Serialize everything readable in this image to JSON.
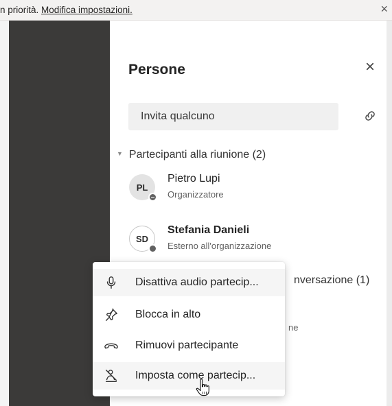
{
  "notification": {
    "text": "n priorità. ",
    "link": "Modifica impostazioni.",
    "close_glyph": "×"
  },
  "panel": {
    "title": "Persone",
    "close_glyph": "×",
    "invite_placeholder": "Invita qualcuno"
  },
  "meeting_section": {
    "label": "Partecipanti alla riunione (2)",
    "participants": [
      {
        "initials": "PL",
        "name": "Pietro Lupi",
        "role": "Organizzatore"
      },
      {
        "initials": "SD",
        "name": "Stefania Danieli",
        "role": "Esterno all'organizzazione"
      }
    ]
  },
  "partially_hidden": {
    "conversation_section": "nversazione (1)",
    "role_fragment": "ne"
  },
  "context_menu": {
    "items": [
      {
        "label": "Disattiva audio partecip...",
        "icon": "microphone-icon"
      },
      {
        "label": "Blocca in alto",
        "icon": "pin-icon"
      },
      {
        "label": "Rimuovi partecipante",
        "icon": "hang-up-icon"
      },
      {
        "label": "Imposta come partecip...",
        "icon": "attendee-icon"
      }
    ]
  }
}
